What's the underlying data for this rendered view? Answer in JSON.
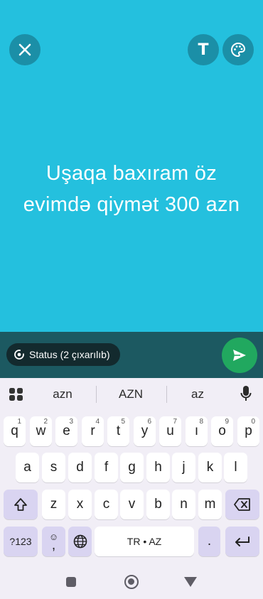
{
  "composer": {
    "status_text": "Uşaqa baxıram öz evimdə qiymət 300 azn",
    "background_color": "#24C0DE",
    "buttons": {
      "close_icon": "close-icon",
      "text_label": "T",
      "palette_icon": "palette-icon"
    }
  },
  "bottom_bar": {
    "audience_label": "Status (2 çıxarılıb)",
    "audience_icon": "status-ring-icon",
    "send_icon": "send-icon"
  },
  "keyboard": {
    "suggestions": [
      "azn",
      "AZN",
      "az"
    ],
    "row1": [
      {
        "key": "q",
        "hint": "1"
      },
      {
        "key": "w",
        "hint": "2"
      },
      {
        "key": "e",
        "hint": "3"
      },
      {
        "key": "r",
        "hint": "4"
      },
      {
        "key": "t",
        "hint": "5"
      },
      {
        "key": "y",
        "hint": "6"
      },
      {
        "key": "u",
        "hint": "7"
      },
      {
        "key": "ı",
        "hint": "8"
      },
      {
        "key": "o",
        "hint": "9"
      },
      {
        "key": "p",
        "hint": "0"
      }
    ],
    "row2": [
      "a",
      "s",
      "d",
      "f",
      "g",
      "h",
      "j",
      "k",
      "l"
    ],
    "row3": [
      "z",
      "x",
      "c",
      "v",
      "b",
      "n",
      "m"
    ],
    "symbols_label": "?123",
    "comma_label": ",",
    "emoji_hint": "☺",
    "space_label": "TR • AZ",
    "period_label": "."
  }
}
